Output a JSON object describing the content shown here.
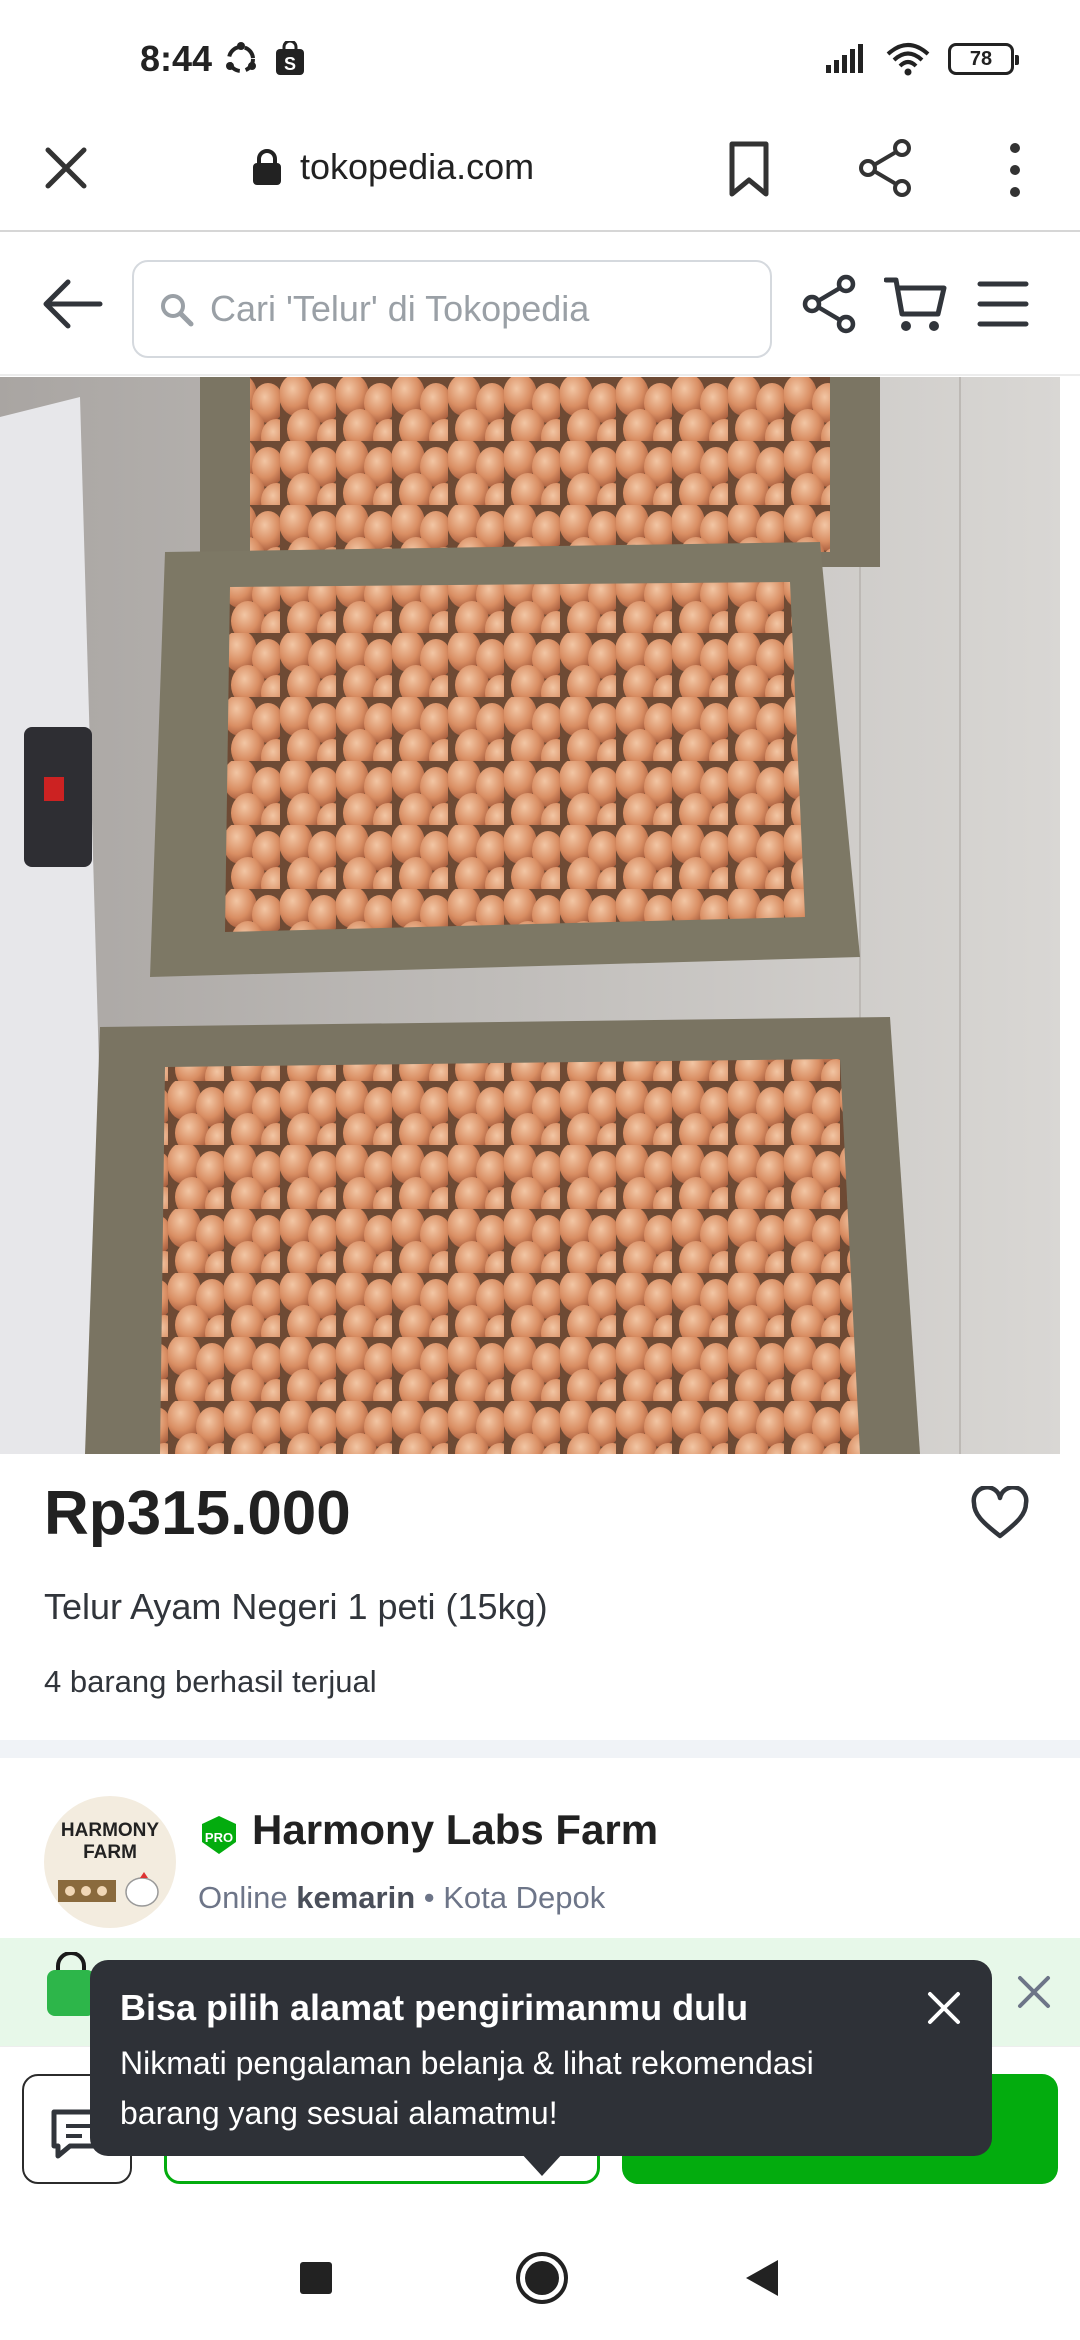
{
  "status_bar": {
    "time": "8:44",
    "battery": "78",
    "icons": [
      "sync-icon",
      "shop-notification-icon",
      "signal-icon",
      "wifi-icon",
      "battery-icon"
    ]
  },
  "browser": {
    "url": "tokopedia.com",
    "icons": [
      "close-icon",
      "lock-icon",
      "bookmark-icon",
      "share-icon",
      "more-icon"
    ]
  },
  "header": {
    "search_placeholder": "Cari 'Telur' di Tokopedia",
    "icons": [
      "back-arrow-icon",
      "search-icon",
      "share-icon",
      "cart-icon",
      "menu-icon"
    ]
  },
  "product": {
    "image_description_icon": "product-photo",
    "price": "Rp315.000",
    "title": "Telur Ayam Negeri 1 peti (15kg)",
    "sold": "4 barang berhasil terjual"
  },
  "shop": {
    "avatar_text_1": "HARMONY",
    "avatar_text_2": "FARM",
    "badge_text": "PRO",
    "name": "Harmony Labs Farm",
    "status_prefix": "Online",
    "status_time": "kemarin",
    "status_suffix": "• Kota Depok"
  },
  "tooltip": {
    "title": "Bisa pilih alamat pengirimanmu dulu",
    "body": "Nikmati pengalaman belanja & lihat rekomendasi barang yang sesuai alamatmu!"
  },
  "colors": {
    "brand_green": "#03ac0e",
    "tooltip_bg": "#2e3137",
    "promo_bg": "#e7f8e9"
  }
}
